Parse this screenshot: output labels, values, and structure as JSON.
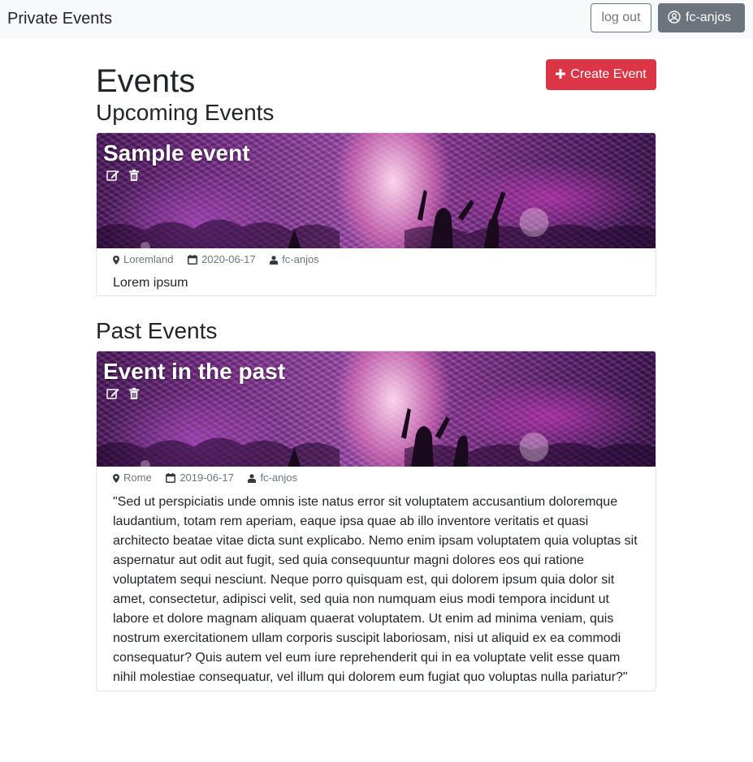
{
  "navbar": {
    "brand": "Private Events",
    "logout_label": "log out",
    "user_label": "fc-anjos",
    "user_icon": "user-circle-icon"
  },
  "page": {
    "title": "Events",
    "create_label": "Create Event",
    "create_icon": "plus-icon",
    "accent_color": "#dc3545"
  },
  "upcoming": {
    "heading": "Upcoming Events",
    "events": [
      {
        "title": "Sample event",
        "location": "Loremland",
        "date": "2020-06-17",
        "author": "fc-anjos",
        "description": "Lorem ipsum"
      }
    ]
  },
  "past": {
    "heading": "Past Events",
    "events": [
      {
        "title": "Event in the past",
        "location": "Rome",
        "date": "2019-06-17",
        "author": "fc-anjos",
        "description": "\"Sed ut perspiciatis unde omnis iste natus error sit voluptatem accusantium doloremque laudantium, totam rem aperiam, eaque ipsa quae ab illo inventore veritatis et quasi architecto beatae vitae dicta sunt explicabo. Nemo enim ipsam voluptatem quia voluptas sit aspernatur aut odit aut fugit, sed quia consequuntur magni dolores eos qui ratione voluptatem sequi nesciunt. Neque porro quisquam est, qui dolorem ipsum quia dolor sit amet, consectetur, adipisci velit, sed quia non numquam eius modi tempora incidunt ut labore et dolore magnam aliquam quaerat voluptatem. Ut enim ad minima veniam, quis nostrum exercitationem ullam corporis suscipit laboriosam, nisi ut aliquid ex ea commodi consequatur? Quis autem vel eum iure reprehenderit qui in ea voluptate velit esse quam nihil molestiae consequatur, vel illum qui dolorem eum fugiat quo voluptas nulla pariatur?\""
      }
    ]
  },
  "icons": {
    "edit": "edit-icon",
    "delete": "trash-icon",
    "location": "map-marker-icon",
    "date": "calendar-icon",
    "author": "user-icon"
  }
}
